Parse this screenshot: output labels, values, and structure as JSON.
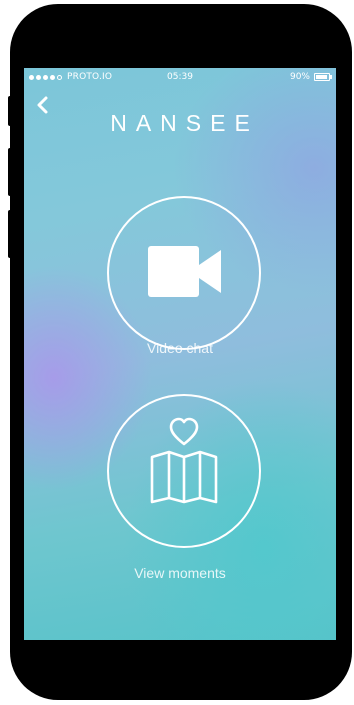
{
  "status_bar": {
    "carrier": "PROTO.IO",
    "time": "05:39",
    "battery_percent": "90%",
    "battery_level": 0.9,
    "signal_bars": 4
  },
  "header": {
    "title": "NANSEE",
    "back_icon": "chevron-left-icon"
  },
  "actions": [
    {
      "label": "Video chat",
      "icon": "video-camera-icon"
    },
    {
      "label": "View moments",
      "icon": "map-heart-icon"
    }
  ],
  "colors": {
    "foreground": "#ffffff",
    "gradient_teal": "#57c3c9",
    "gradient_lavender": "#aa96eb"
  }
}
